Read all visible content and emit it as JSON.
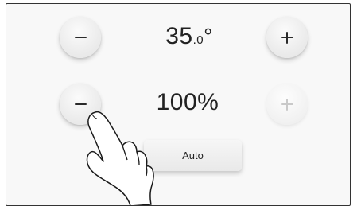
{
  "temperature": {
    "integer": "35",
    "decimal": ".0",
    "unit": "°",
    "decrease_icon": "minus-icon",
    "increase_icon": "plus-icon"
  },
  "humidity": {
    "value": "100%",
    "decrease_icon": "minus-icon",
    "increase_icon": "plus-icon",
    "increase_disabled": true
  },
  "mode_button": {
    "label": "Auto"
  },
  "overlay": {
    "icon": "pointing-hand-icon"
  }
}
